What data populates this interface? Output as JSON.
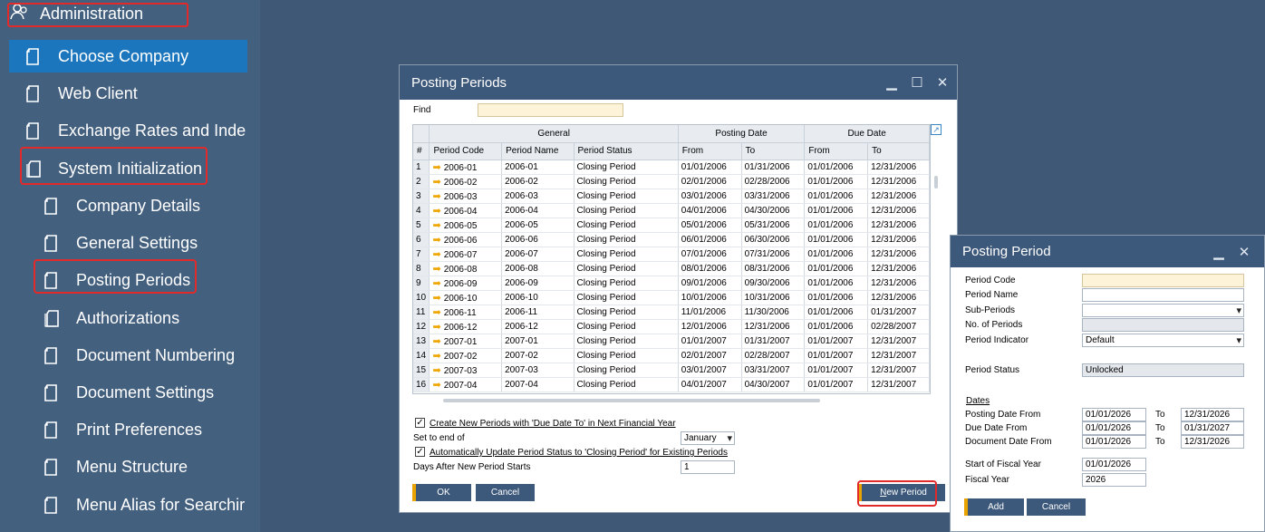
{
  "sidebar": {
    "header": "Administration",
    "items": [
      {
        "label": "Choose Company",
        "level": 1,
        "active": true
      },
      {
        "label": "Web Client",
        "level": 1
      },
      {
        "label": "Exchange Rates and Inde",
        "level": 1
      },
      {
        "label": "System Initialization",
        "level": 1
      },
      {
        "label": "Company Details",
        "level": 2
      },
      {
        "label": "General Settings",
        "level": 2
      },
      {
        "label": "Posting Periods",
        "level": 2
      },
      {
        "label": "Authorizations",
        "level": 2
      },
      {
        "label": "Document Numbering",
        "level": 2
      },
      {
        "label": "Document Settings",
        "level": 2
      },
      {
        "label": "Print Preferences",
        "level": 2
      },
      {
        "label": "Menu Structure",
        "level": 2
      },
      {
        "label": "Menu Alias for Searchir",
        "level": 2
      }
    ]
  },
  "posting_periods": {
    "title": "Posting Periods",
    "find_label": "Find",
    "find_value": "",
    "group_headers": {
      "general": "General",
      "posting_date": "Posting Date",
      "due_date": "Due Date"
    },
    "columns": [
      "#",
      "Period Code",
      "Period Name",
      "Period Status",
      "From",
      "To",
      "From",
      "To"
    ],
    "rows": [
      [
        "1",
        "2006-01",
        "2006-01",
        "Closing Period",
        "01/01/2006",
        "01/31/2006",
        "01/01/2006",
        "12/31/2006"
      ],
      [
        "2",
        "2006-02",
        "2006-02",
        "Closing Period",
        "02/01/2006",
        "02/28/2006",
        "01/01/2006",
        "12/31/2006"
      ],
      [
        "3",
        "2006-03",
        "2006-03",
        "Closing Period",
        "03/01/2006",
        "03/31/2006",
        "01/01/2006",
        "12/31/2006"
      ],
      [
        "4",
        "2006-04",
        "2006-04",
        "Closing Period",
        "04/01/2006",
        "04/30/2006",
        "01/01/2006",
        "12/31/2006"
      ],
      [
        "5",
        "2006-05",
        "2006-05",
        "Closing Period",
        "05/01/2006",
        "05/31/2006",
        "01/01/2006",
        "12/31/2006"
      ],
      [
        "6",
        "2006-06",
        "2006-06",
        "Closing Period",
        "06/01/2006",
        "06/30/2006",
        "01/01/2006",
        "12/31/2006"
      ],
      [
        "7",
        "2006-07",
        "2006-07",
        "Closing Period",
        "07/01/2006",
        "07/31/2006",
        "01/01/2006",
        "12/31/2006"
      ],
      [
        "8",
        "2006-08",
        "2006-08",
        "Closing Period",
        "08/01/2006",
        "08/31/2006",
        "01/01/2006",
        "12/31/2006"
      ],
      [
        "9",
        "2006-09",
        "2006-09",
        "Closing Period",
        "09/01/2006",
        "09/30/2006",
        "01/01/2006",
        "12/31/2006"
      ],
      [
        "10",
        "2006-10",
        "2006-10",
        "Closing Period",
        "10/01/2006",
        "10/31/2006",
        "01/01/2006",
        "12/31/2006"
      ],
      [
        "11",
        "2006-11",
        "2006-11",
        "Closing Period",
        "11/01/2006",
        "11/30/2006",
        "01/01/2006",
        "01/31/2007"
      ],
      [
        "12",
        "2006-12",
        "2006-12",
        "Closing Period",
        "12/01/2006",
        "12/31/2006",
        "01/01/2006",
        "02/28/2007"
      ],
      [
        "13",
        "2007-01",
        "2007-01",
        "Closing Period",
        "01/01/2007",
        "01/31/2007",
        "01/01/2007",
        "12/31/2007"
      ],
      [
        "14",
        "2007-02",
        "2007-02",
        "Closing Period",
        "02/01/2007",
        "02/28/2007",
        "01/01/2007",
        "12/31/2007"
      ],
      [
        "15",
        "2007-03",
        "2007-03",
        "Closing Period",
        "03/01/2007",
        "03/31/2007",
        "01/01/2007",
        "12/31/2007"
      ],
      [
        "16",
        "2007-04",
        "2007-04",
        "Closing Period",
        "04/01/2007",
        "04/30/2007",
        "01/01/2007",
        "12/31/2007"
      ]
    ],
    "create_new_label": "Create New Periods with 'Due Date To' in Next Financial Year",
    "create_new_checked": true,
    "set_to_end_label": "Set to end of",
    "set_to_end_value": "January",
    "auto_update_label": "Automatically Update Period Status to 'Closing Period' for Existing Periods",
    "auto_update_checked": true,
    "days_after_label": "Days After New Period Starts",
    "days_after_value": "1",
    "ok_label": "OK",
    "cancel_label": "Cancel",
    "new_period_label_first": "N",
    "new_period_label_rest": "ew Period"
  },
  "posting_period": {
    "title": "Posting Period",
    "fields": {
      "period_code_label": "Period Code",
      "period_code_value": "",
      "period_name_label": "Period Name",
      "period_name_value": "",
      "sub_periods_label": "Sub-Periods",
      "sub_periods_value": "",
      "no_periods_label": "No. of Periods",
      "no_periods_value": "",
      "period_indicator_label": "Period Indicator",
      "period_indicator_value": "Default",
      "period_status_label": "Period Status",
      "period_status_value": "Unlocked"
    },
    "dates_section": "Dates",
    "to_label": "To",
    "posting_from_label": "Posting Date From",
    "posting_from": "01/01/2026",
    "posting_to": "12/31/2026",
    "due_from_label": "Due Date From",
    "due_from": "01/01/2026",
    "due_to": "01/31/2027",
    "doc_from_label": "Document Date From",
    "doc_from": "01/01/2026",
    "doc_to": "12/31/2026",
    "start_fiscal_label": "Start of Fiscal Year",
    "start_fiscal": "01/01/2026",
    "fiscal_year_label": "Fiscal Year",
    "fiscal_year": "2026",
    "add_label": "Add",
    "cancel_label": "Cancel"
  },
  "colors": {
    "accent": "#1b76bd",
    "title_bar": "#3c587a",
    "highlight": "#e22a2a",
    "button_marker": "#e9a300"
  }
}
